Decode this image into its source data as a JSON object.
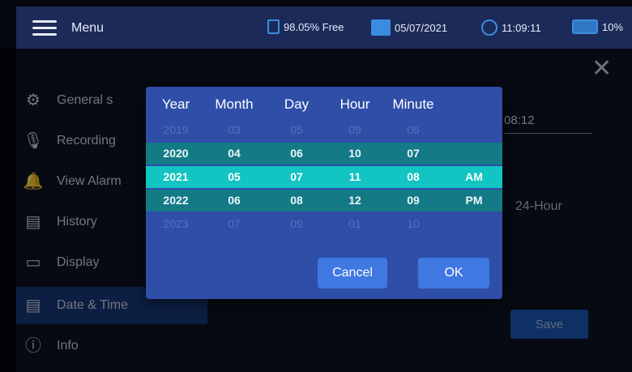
{
  "topbar": {
    "menu_label": "Menu",
    "storage": "98.05% Free",
    "date": "05/07/2021",
    "time": "11:09:11",
    "battery": "10%"
  },
  "sidebar": {
    "items": [
      {
        "label": "General s",
        "icon": "gear-icon"
      },
      {
        "label": "Recording",
        "icon": "microphone-icon"
      },
      {
        "label": "View Alarm",
        "icon": "bell-icon"
      },
      {
        "label": "History",
        "icon": "history-icon"
      },
      {
        "label": "Display",
        "icon": "monitor-icon"
      },
      {
        "label": "Date & Time",
        "icon": "calendar-clock-icon"
      },
      {
        "label": "Info",
        "icon": "info-icon"
      }
    ]
  },
  "settings": {
    "time_value": "08:12",
    "format_text": "24-Hour",
    "save_label": "Save"
  },
  "picker": {
    "headers": {
      "year": "Year",
      "month": "Month",
      "day": "Day",
      "hour": "Hour",
      "minute": "Minute"
    },
    "rows": [
      {
        "year": "2019",
        "month": "03",
        "day": "05",
        "hour": "09",
        "minute": "06",
        "ampm": ""
      },
      {
        "year": "2020",
        "month": "04",
        "day": "06",
        "hour": "10",
        "minute": "07",
        "ampm": ""
      },
      {
        "year": "2021",
        "month": "05",
        "day": "07",
        "hour": "11",
        "minute": "08",
        "ampm": "AM"
      },
      {
        "year": "2022",
        "month": "06",
        "day": "08",
        "hour": "12",
        "minute": "09",
        "ampm": "PM"
      },
      {
        "year": "2023",
        "month": "07",
        "day": "09",
        "hour": "01",
        "minute": "10",
        "ampm": ""
      }
    ],
    "cancel_label": "Cancel",
    "ok_label": "OK"
  },
  "colors": {
    "topbar": "#1c2a5a",
    "dialog": "#2e4ea8",
    "selected_row": "#12c4c2",
    "adjacent_row": "#137a86",
    "button": "#3f78e0"
  }
}
